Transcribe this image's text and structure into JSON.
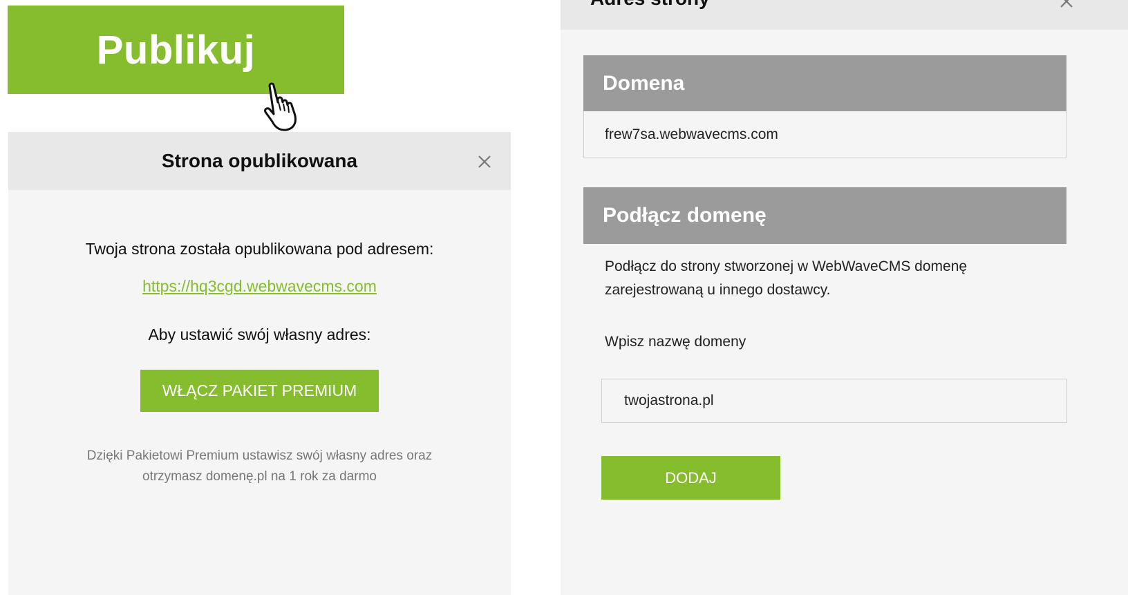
{
  "publish_button": {
    "label": "Publikuj"
  },
  "published_dialog": {
    "title": "Strona opublikowana",
    "message": "Twoja strona została opublikowana pod adresem:",
    "url": "https://hq3cgd.webwavecms.com",
    "custom_address_prompt": "Aby ustawić swój własny adres:",
    "premium_button": "WŁĄCZ PAKIET PREMIUM",
    "note_line1": "Dzięki Pakietowi Premium ustawisz swój własny adres oraz",
    "note_line2": "otrzymasz domenę.pl na 1 rok za darmo"
  },
  "address_panel": {
    "title": "Adres strony",
    "domain_section": {
      "heading": "Domena",
      "value": "frew7sa.webwavecms.com"
    },
    "connect_section": {
      "heading": "Podłącz domenę",
      "description_line1": "Podłącz do strony stworzonej w WebWaveCMS domenę",
      "description_line2": "zarejestrowaną u innego dostawcy.",
      "input_label": "Wpisz nazwę domeny",
      "input_value": "twojastrona.pl",
      "add_button": "DODAJ"
    }
  },
  "colors": {
    "accent": "#86bd2e",
    "section_header": "#9b9b9b",
    "panel_bg": "#f5f5f5",
    "header_bg": "#e8e8e8"
  },
  "icons": {
    "close": "close-icon",
    "cursor": "hand-cursor-icon"
  }
}
